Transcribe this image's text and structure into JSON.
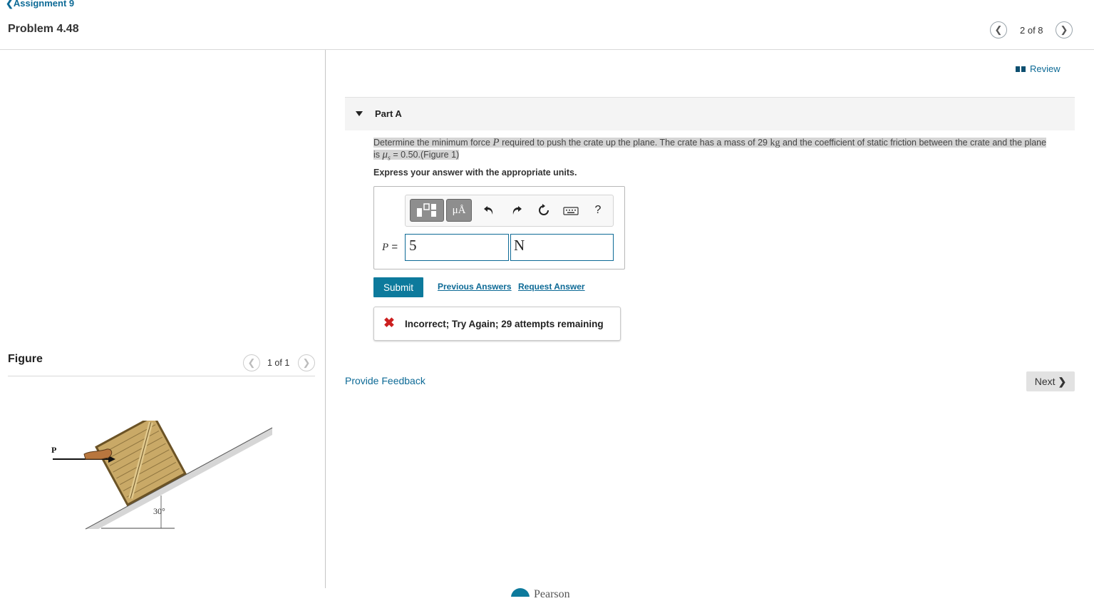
{
  "header": {
    "back_link": "Assignment 9",
    "problem_title": "Problem 4.48",
    "pager": "2 of 8"
  },
  "review": {
    "label": "Review"
  },
  "part": {
    "label": "Part A"
  },
  "question": {
    "t1": "Determine the minimum force ",
    "sym_P": "P",
    "t2": " required to push the crate up the plane. The crate has a mass of 29 ",
    "unit_kg": "kg",
    "t3": " and the coefficient of static friction between the crate and the plane is ",
    "mu": "μ",
    "mu_sub": "s",
    "t4": " = 0.50.",
    "figure_link": "(Figure 1)",
    "instruction": "Express your answer with the appropriate units."
  },
  "answer": {
    "label_var": "P",
    "label_eq": " = ",
    "value": "5",
    "unit": "N",
    "units_button": "μÅ",
    "help_button": "?"
  },
  "actions": {
    "submit": "Submit",
    "previous_answers": "Previous Answers",
    "request_answer": "Request Answer"
  },
  "feedback": {
    "status": "Incorrect; Try Again; 29 attempts remaining",
    "status_color": "#cc1f1f"
  },
  "footer": {
    "provide_feedback": "Provide Feedback",
    "next": "Next",
    "brand": "Pearson"
  },
  "figure": {
    "title": "Figure",
    "pager": "1 of 1",
    "label_P": "P",
    "angle": "30°"
  },
  "colors": {
    "accent": "#0d6a96",
    "submit_bg": "#0d7a9c"
  }
}
